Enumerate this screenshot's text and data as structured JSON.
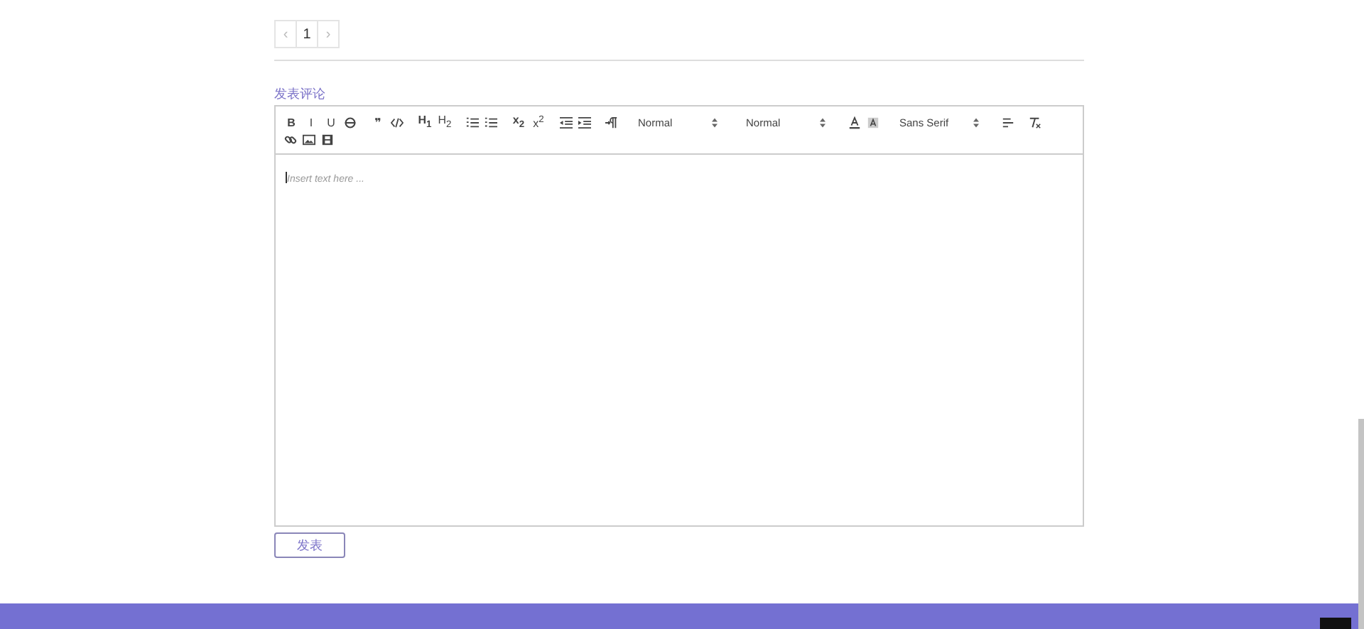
{
  "pagination": {
    "prev": "‹",
    "pages": [
      {
        "label": "1",
        "selected": true
      }
    ],
    "next": "›"
  },
  "comment": {
    "heading": "发表评论",
    "toolbar": [
      [
        [
          {
            "kind": "text",
            "label": "B"
          },
          {
            "kind": "text",
            "label": "I"
          },
          {
            "kind": "text",
            "label": "U"
          },
          {
            "kind": "strike"
          }
        ],
        [
          {
            "kind": "text",
            "label": "❞"
          },
          {
            "kind": "code"
          }
        ],
        [
          {
            "kind": "text",
            "label": "H$_{1}$"
          },
          {
            "kind": "text",
            "label": "H$_{2}$"
          }
        ],
        [
          {
            "kind": "ol"
          },
          {
            "kind": "ul"
          }
        ],
        [
          {
            "kind": "text",
            "label": "x$_{2}$"
          },
          {
            "kind": "text",
            "label": "x$^{2}$"
          }
        ],
        [
          {
            "kind": "outdent"
          },
          {
            "kind": "indent"
          }
        ],
        [
          {
            "kind": "direction"
          }
        ],
        [
          {
            "kind": "select",
            "label": "Normal"
          }
        ],
        [
          {
            "kind": "select",
            "label": "Normal"
          }
        ],
        [
          {
            "kind": "color"
          },
          {
            "kind": "background"
          }
        ],
        [
          {
            "kind": "select",
            "label": "Sans Serif"
          }
        ],
        [
          {
            "kind": "align"
          }
        ],
        [
          {
            "kind": "clean"
          }
        ]
      ],
      [
        [
          {
            "kind": "link"
          },
          {
            "kind": "image"
          },
          {
            "kind": "video"
          }
        ]
      ]
    ],
    "placeholder": "Insert text here ...",
    "submit": "发表"
  }
}
